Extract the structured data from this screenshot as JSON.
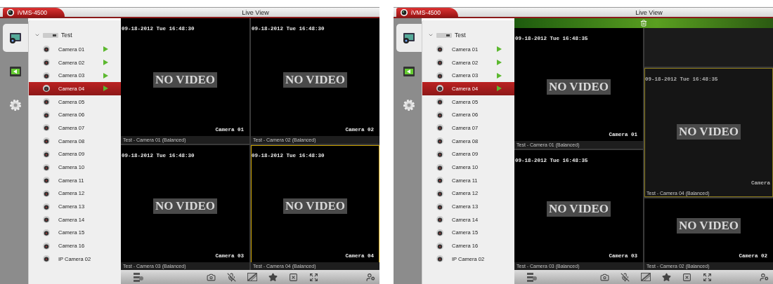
{
  "screens": [
    {
      "app_tab": "iVMS-4500",
      "title": "Live View",
      "rail": [
        {
          "kind": "live",
          "selected": true
        },
        {
          "kind": "playback",
          "selected": false
        },
        {
          "kind": "settings",
          "selected": false
        }
      ],
      "tree": {
        "label": "Test",
        "expanded": true,
        "children": [
          {
            "label": "Camera 01",
            "playing": true,
            "selected": false
          },
          {
            "label": "Camera 02",
            "playing": true,
            "selected": false
          },
          {
            "label": "Camera 03",
            "playing": true,
            "selected": false
          },
          {
            "label": "Camera 04",
            "playing": true,
            "selected": true
          },
          {
            "label": "Camera 05",
            "playing": false,
            "selected": false
          },
          {
            "label": "Camera 06",
            "playing": false,
            "selected": false
          },
          {
            "label": "Camera 07",
            "playing": false,
            "selected": false
          },
          {
            "label": "Camera 08",
            "playing": false,
            "selected": false
          },
          {
            "label": "Camera 09",
            "playing": false,
            "selected": false
          },
          {
            "label": "Camera 10",
            "playing": false,
            "selected": false
          },
          {
            "label": "Camera 11",
            "playing": false,
            "selected": false
          },
          {
            "label": "Camera 12",
            "playing": false,
            "selected": false
          },
          {
            "label": "Camera 13",
            "playing": false,
            "selected": false
          },
          {
            "label": "Camera 14",
            "playing": false,
            "selected": false
          },
          {
            "label": "Camera 15",
            "playing": false,
            "selected": false
          },
          {
            "label": "Camera 16",
            "playing": false,
            "selected": false
          },
          {
            "label": "IP Camera 02",
            "playing": false,
            "selected": false
          }
        ]
      },
      "grid": {
        "trash_bar": false,
        "cells": [
          {
            "kind": "video",
            "timestamp": "09-18-2012 Tue 16:48:30",
            "overlay": "NO VIDEO",
            "name": "Camera 01",
            "caption": "Test - Camera 01 (Balanced)",
            "selected": false
          },
          {
            "kind": "video",
            "timestamp": "09-18-2012 Tue 16:48:30",
            "overlay": "NO VIDEO",
            "name": "Camera 02",
            "caption": "Test - Camera 02 (Balanced)",
            "selected": false
          },
          {
            "kind": "video",
            "timestamp": "09-18-2012 Tue 16:48:30",
            "overlay": "NO VIDEO",
            "name": "Camera 03",
            "caption": "Test - Camera 03 (Balanced)",
            "selected": false
          },
          {
            "kind": "video",
            "timestamp": "09-18-2012 Tue 16:48:30",
            "overlay": "NO VIDEO",
            "name": "Camera 04",
            "caption": "Test - Camera 04 (Balanced)",
            "selected": true
          }
        ]
      }
    },
    {
      "app_tab": "iVMS-4500",
      "title": "Live View",
      "rail": [
        {
          "kind": "live",
          "selected": true
        },
        {
          "kind": "playback",
          "selected": false
        },
        {
          "kind": "settings",
          "selected": false
        }
      ],
      "tree": {
        "label": "Test",
        "expanded": true,
        "children": [
          {
            "label": "Camera 01",
            "playing": true,
            "selected": false
          },
          {
            "label": "Camera 02",
            "playing": true,
            "selected": false
          },
          {
            "label": "Camera 03",
            "playing": true,
            "selected": false
          },
          {
            "label": "Camera 04",
            "playing": true,
            "selected": true
          },
          {
            "label": "Camera 05",
            "playing": false,
            "selected": false
          },
          {
            "label": "Camera 06",
            "playing": false,
            "selected": false
          },
          {
            "label": "Camera 07",
            "playing": false,
            "selected": false
          },
          {
            "label": "Camera 08",
            "playing": false,
            "selected": false
          },
          {
            "label": "Camera 09",
            "playing": false,
            "selected": false
          },
          {
            "label": "Camera 10",
            "playing": false,
            "selected": false
          },
          {
            "label": "Camera 11",
            "playing": false,
            "selected": false
          },
          {
            "label": "Camera 12",
            "playing": false,
            "selected": false
          },
          {
            "label": "Camera 13",
            "playing": false,
            "selected": false
          },
          {
            "label": "Camera 14",
            "playing": false,
            "selected": false
          },
          {
            "label": "Camera 15",
            "playing": false,
            "selected": false
          },
          {
            "label": "Camera 16",
            "playing": false,
            "selected": false
          },
          {
            "label": "IP Camera 02",
            "playing": false,
            "selected": false
          }
        ]
      },
      "grid": {
        "trash_bar": true,
        "cells": [
          {
            "kind": "video",
            "timestamp": "09-18-2012 Tue 16:48:35",
            "overlay": "NO VIDEO",
            "name": "Camera 01",
            "caption": "Test - Camera 01 (Balanced)",
            "selected": false
          },
          {
            "kind": "empty"
          },
          {
            "kind": "video",
            "timestamp": "09-18-2012 Tue 16:48:35",
            "overlay": "NO VIDEO",
            "name": "Camera 03",
            "caption": "Test - Camera 03 (Balanced)",
            "selected": false
          },
          {
            "kind": "video",
            "overlay": "NO VIDEO",
            "name": "Camera 02",
            "caption": "Test - Camera 02 (Balanced)",
            "selected": false
          }
        ],
        "drag_tile": {
          "timestamp": "09-18-2012 Tue 16:48:35",
          "overlay": "NO VIDEO",
          "name": "Camera",
          "caption": "Test - Camera 04 (Balanced)"
        }
      }
    }
  ]
}
